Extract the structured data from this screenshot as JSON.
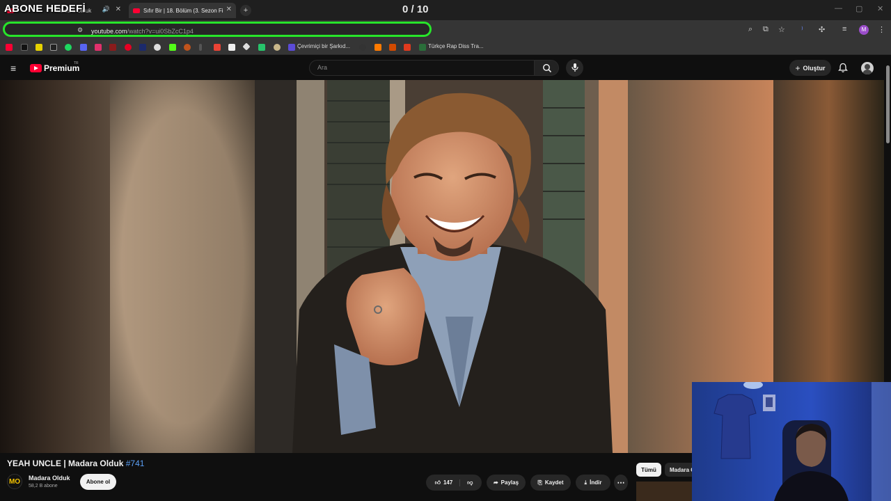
{
  "overlay": {
    "title": "ABONE HEDEFİ",
    "counter": "0 / 10"
  },
  "browser": {
    "tabs": [
      {
        "label": "Madara Olduk",
        "audio_icon": "speaker-icon"
      },
      {
        "label": "Sıfır Bir | 18. Bölüm (3. Sezon Fi"
      }
    ],
    "new_tab_glyph": "+",
    "url_host": "youtube.com",
    "url_path": "/watch?v=ui0SbZcC1p4",
    "bookmarks": [
      {
        "label": "Çevrimiçi bir Şarkıd..."
      },
      {
        "label": "Türkçe Rap Diss Tra..."
      }
    ]
  },
  "youtube": {
    "logo_text": "Premium",
    "logo_region": "TR",
    "search_placeholder": "Ara",
    "create_label": "Oluştur",
    "video": {
      "title": "YEAH UNCLE | Madara Olduk ",
      "episode_tag": "#741",
      "channel_name": "Madara Olduk",
      "channel_logo": "MO",
      "subscribers": "58,2 B abone",
      "subscribe_label": "Abone ol",
      "like_count": "147",
      "share_label": "Paylaş",
      "save_label": "Kaydet",
      "download_label": "İndir"
    },
    "chips": [
      "Tümü",
      "Madara O"
    ]
  },
  "colors": {
    "accent_green": "#27e52a",
    "youtube_red": "#ff0033",
    "link_blue": "#5b9ff5"
  }
}
